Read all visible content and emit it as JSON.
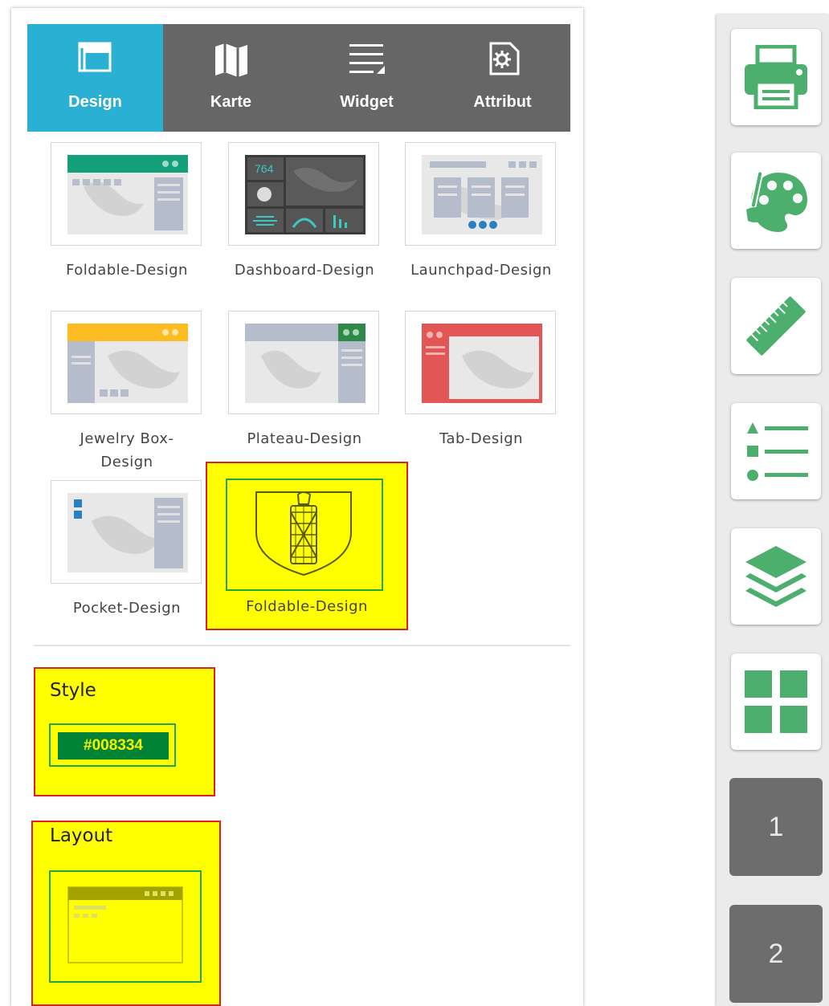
{
  "tabs": [
    {
      "label": "Design",
      "icon": "design-icon",
      "active": true
    },
    {
      "label": "Karte",
      "icon": "map-icon",
      "active": false
    },
    {
      "label": "Widget",
      "icon": "widget-icon",
      "active": false
    },
    {
      "label": "Attribut",
      "icon": "attribute-icon",
      "active": false
    }
  ],
  "themes": [
    {
      "label": "Foldable-Design"
    },
    {
      "label": "Dashboard-Design",
      "thumb_value": "764"
    },
    {
      "label": "Launchpad-Design"
    },
    {
      "label": "Jewelry Box-Design"
    },
    {
      "label": "Plateau-Design"
    },
    {
      "label": "Tab-Design"
    },
    {
      "label": "Pocket-Design"
    },
    {
      "label": "Foldable-Design",
      "selected": true
    }
  ],
  "style": {
    "title": "Style",
    "color_label": "#008334",
    "color": "#008334"
  },
  "layout": {
    "title": "Layout"
  },
  "toolbar": {
    "tools": [
      "print-icon",
      "palette-icon",
      "ruler-icon",
      "legend-icon",
      "layers-icon",
      "grid-icon"
    ],
    "pages": [
      "1",
      "2"
    ]
  },
  "colors": {
    "accent": "#29b0d3",
    "tabbar": "#666666",
    "icon_green": "#4caf6e",
    "highlight": "#ffff00",
    "highlight_border": "#e02020",
    "inner_border": "#1ea64a"
  }
}
